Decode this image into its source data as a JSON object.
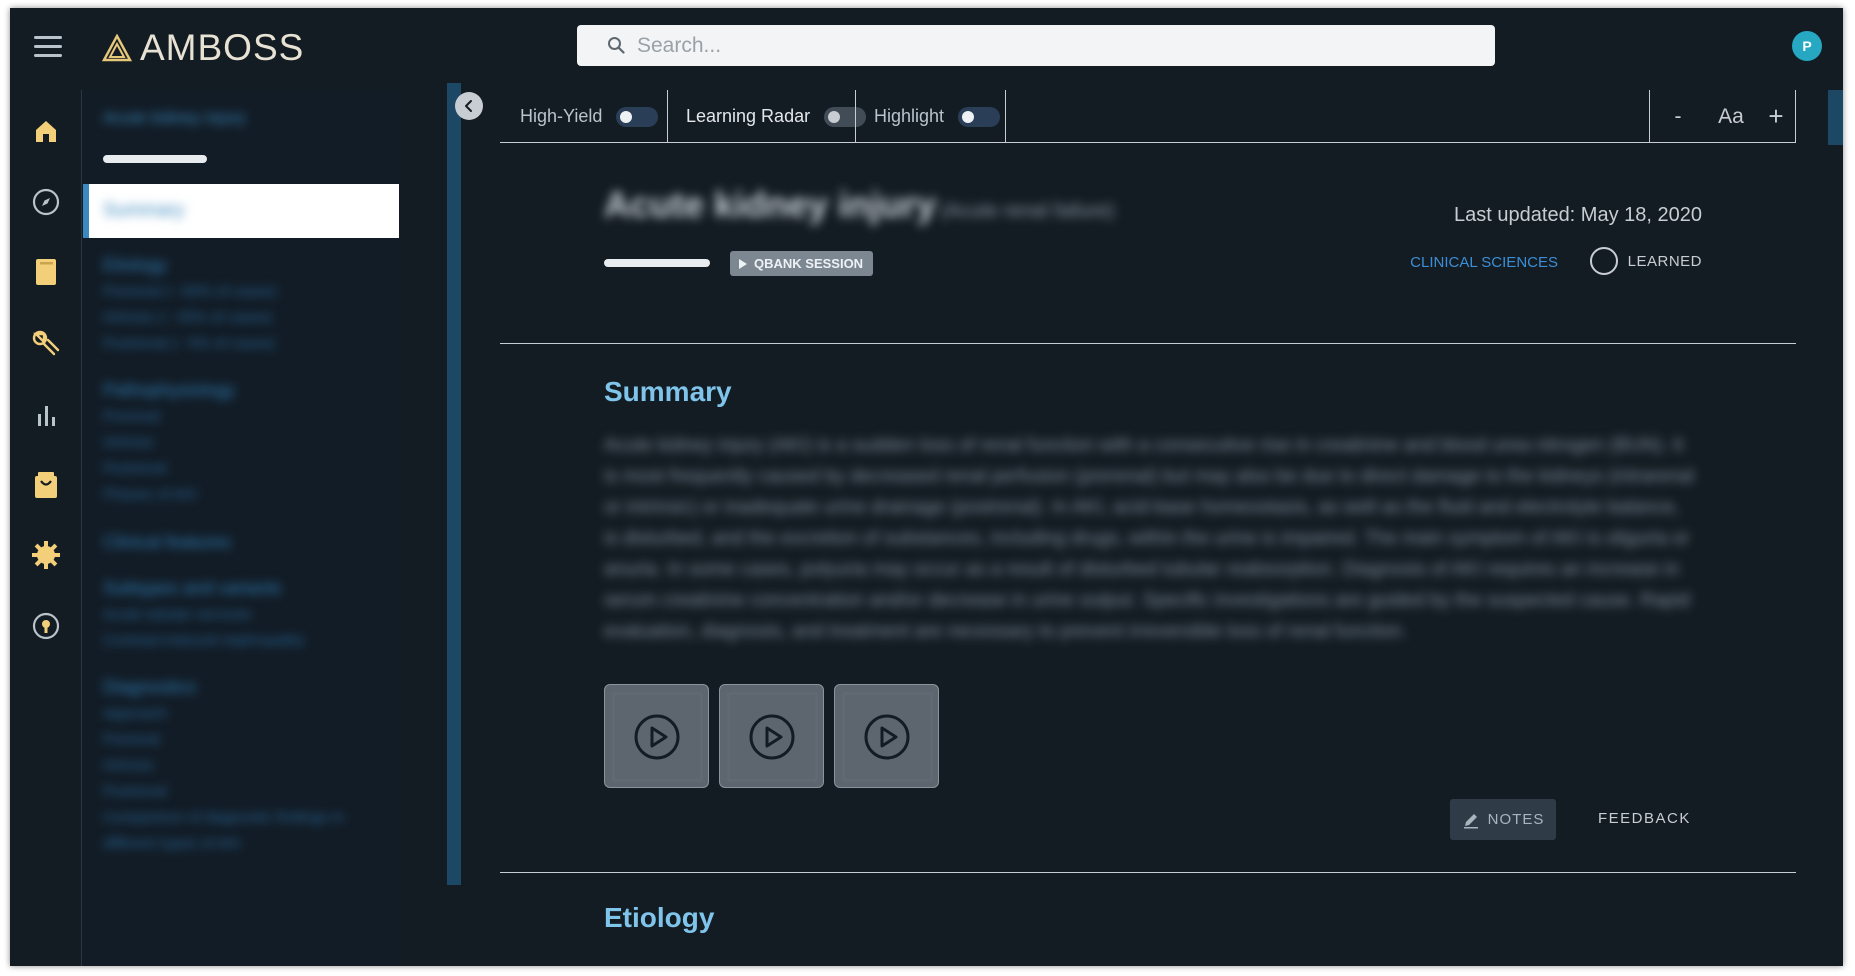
{
  "app": {
    "logo_text": "AMBOSS",
    "search_placeholder": "Search...",
    "avatar_initial": "P"
  },
  "rail": {
    "items": [
      {
        "name": "home-icon"
      },
      {
        "name": "compass-icon"
      },
      {
        "name": "library-icon"
      },
      {
        "name": "pill-icon"
      },
      {
        "name": "stats-icon"
      },
      {
        "name": "bag-icon"
      },
      {
        "name": "gear-icon"
      },
      {
        "name": "help-icon"
      }
    ]
  },
  "toc": {
    "title": "Acute kidney injury",
    "progress": 0.0,
    "active_item": "Summary",
    "sections": [
      {
        "heading": "Etiology",
        "subs": [
          "Prerenal (~ 60% of cases)",
          "Intrinsic (~ 35% of cases)",
          "Postrenal (~ 5% of cases)"
        ]
      },
      {
        "heading": "Pathophysiology",
        "subs": [
          "Prerenal",
          "Intrinsic",
          "Postrenal",
          "Phases of AKI"
        ]
      },
      {
        "heading": "Clinical features",
        "subs": []
      },
      {
        "heading": "Subtypes and variants",
        "subs": [
          "Acute tubular necrosis",
          "Contrast-induced nephropathy"
        ]
      },
      {
        "heading": "Diagnostics",
        "subs": [
          "Approach",
          "Prerenal",
          "Intrinsic",
          "Postrenal",
          "Comparison of diagnostic findings in",
          "different types of AKI"
        ]
      }
    ]
  },
  "toolbar": {
    "high_yield_label": "High-Yield",
    "learning_radar_label": "Learning Radar",
    "highlight_label": "Highlight",
    "font_decrease": "-",
    "font_label": "Aa",
    "font_increase": "+"
  },
  "article": {
    "title": "Acute kidney injury",
    "synonym": "(Acute renal failure)",
    "last_updated": "Last updated: May 18, 2020",
    "qbank_label": "QBANK SESSION",
    "clinical_link": "CLINICAL SCIENCES",
    "learned_label": "LEARNED",
    "summary_heading": "Summary",
    "summary_text": "Acute kidney injury (AKI) is a sudden loss of renal function with a consecutive rise in creatinine and blood urea nitrogen (BUN). It is most frequently caused by decreased renal perfusion (prerenal) but may also be due to direct damage to the kidneys (intrarenal or intrinsic) or inadequate urine drainage (postrenal). In AKI, acid-base homeostasis, as well as the fluid and electrolyte balance, is disturbed, and the excretion of substances, including drugs, within the urine is impaired. The main symptom of AKI is oliguria or anuria. In some cases, polyuria may occur as a result of disturbed tubular reabsorption. Diagnosis of AKI requires an increase in serum creatinine concentration and/or decrease in urine output. Specific investigations are guided by the suspected cause. Rapid evaluation, diagnosis, and treatment are necessary to prevent irreversible loss of renal function.",
    "media_count": 3,
    "notes_label": "NOTES",
    "feedback_label": "FEEDBACK",
    "etiology_heading": "Etiology"
  }
}
